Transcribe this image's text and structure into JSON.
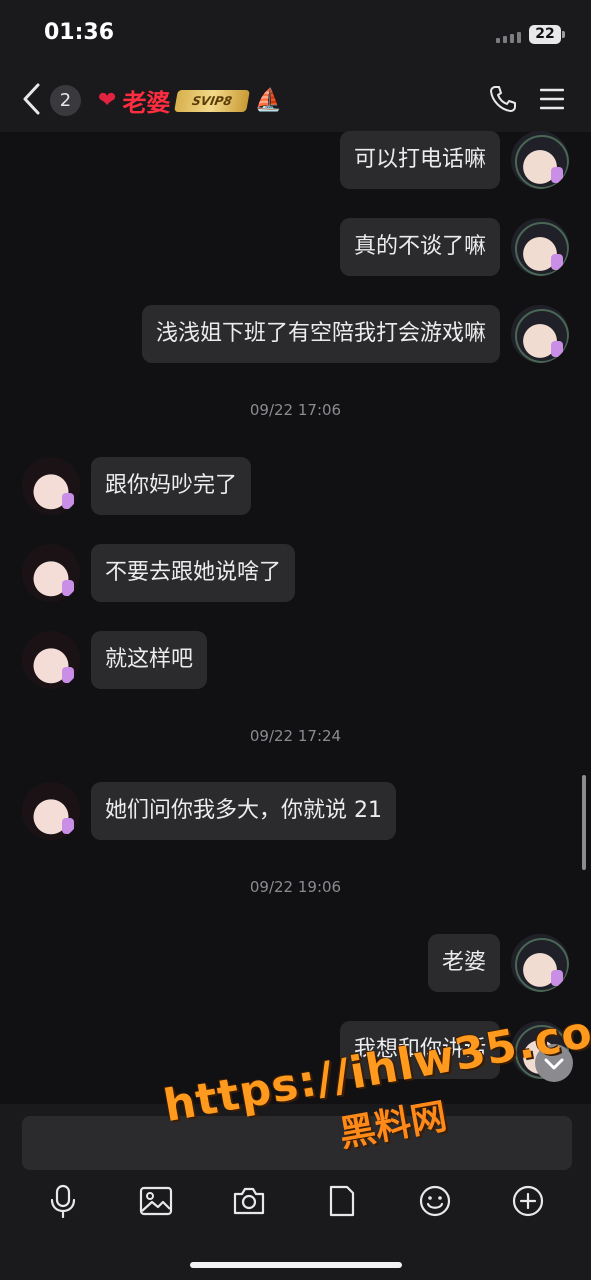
{
  "status_bar": {
    "time": "01:36",
    "battery": "22"
  },
  "header": {
    "unread_count": "2",
    "contact_name": "老婆",
    "vip_badge": "SVIP8"
  },
  "messages": [
    {
      "side": "right",
      "text": "可以打电话嘛"
    },
    {
      "side": "right",
      "text": "真的不谈了嘛"
    },
    {
      "side": "right",
      "text": "浅浅姐下班了有空陪我打会游戏嘛"
    },
    {
      "side": "left",
      "text": "跟你妈吵完了"
    },
    {
      "side": "left",
      "text": "不要去跟她说啥了"
    },
    {
      "side": "left",
      "text": "就这样吧"
    },
    {
      "side": "left",
      "text": "她们问你我多大，你就说 21"
    },
    {
      "side": "right",
      "text": "老婆"
    },
    {
      "side": "right",
      "text": "我想和你讲话"
    }
  ],
  "timestamps": [
    "09/22 17:06",
    "09/22 17:24",
    "09/22 19:06"
  ],
  "input": {
    "placeholder": ""
  },
  "toolbar": {
    "icons": [
      "mic-icon",
      "image-icon",
      "camera-icon",
      "file-icon",
      "emoji-icon",
      "plus-icon"
    ]
  },
  "watermark": {
    "url": "https://ihlw35.com",
    "text": "黑料网"
  },
  "colors": {
    "background": "#111114",
    "bubble": "#2b2b2e",
    "name": "#ff2d40",
    "watermark": "#ff9a1f"
  }
}
